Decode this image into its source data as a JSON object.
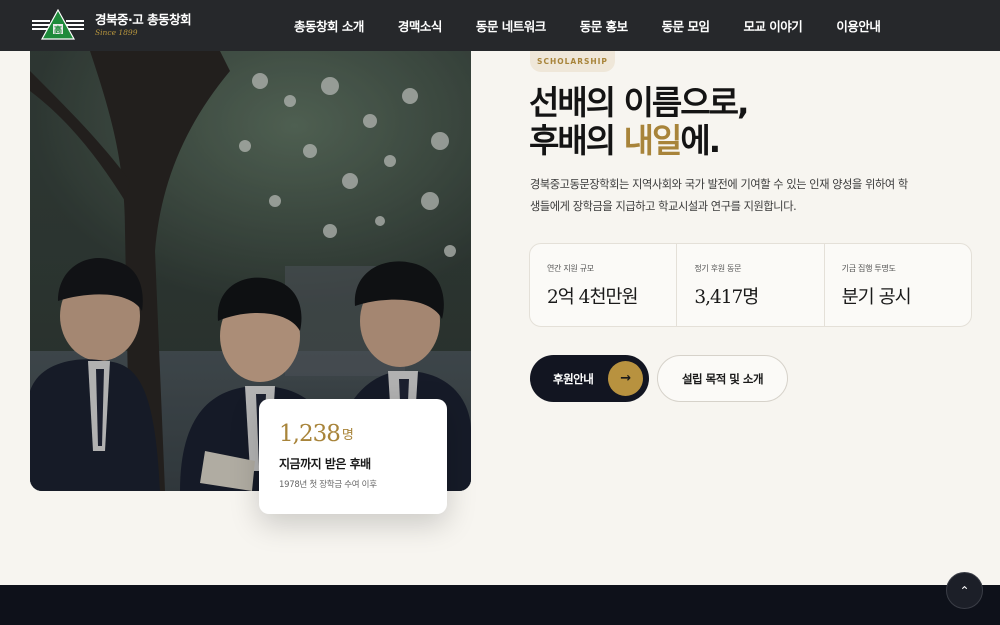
{
  "header": {
    "logo_title": "경북중·고 총동창회",
    "logo_since": "Since 1899",
    "nav": [
      "총동창회 소개",
      "경맥소식",
      "동문 네트워크",
      "동문 홍보",
      "동문 모임",
      "모교 이야기",
      "이용안내"
    ]
  },
  "hero": {
    "badge": "SCHOLARSHIP",
    "headline_line1": "선배의 이름으로,",
    "headline_line2_pre": "후배의 ",
    "headline_line2_accent": "내일",
    "headline_line2_post": "에.",
    "description": "경북중고동문장학회는 지역사회와 국가 발전에 기여할 수 있는 인재 양성을 위하여 학생들에게 장학금을 지급하고 학교시설과 연구를 지원합니다.",
    "stats": [
      {
        "label": "연간 지원 규모",
        "value": "2억 4천만원"
      },
      {
        "label": "정기 후원 동문",
        "value": "3,417명"
      },
      {
        "label": "기금 집행 투명도",
        "value": "분기 공시"
      }
    ],
    "primary_button": "후원안내",
    "primary_button_icon": "→",
    "secondary_button": "설립 목적 및 소개"
  },
  "stat_card": {
    "number": "1,238",
    "unit": "명",
    "title": "지금까지 받은 후배",
    "subtitle": "1978년 첫 장학금 수여 이후"
  },
  "scroll_top_icon": "⌃",
  "colors": {
    "accent": "#a8843a",
    "dark": "#121521",
    "header": "#26282b",
    "background": "#f7f5f0"
  }
}
